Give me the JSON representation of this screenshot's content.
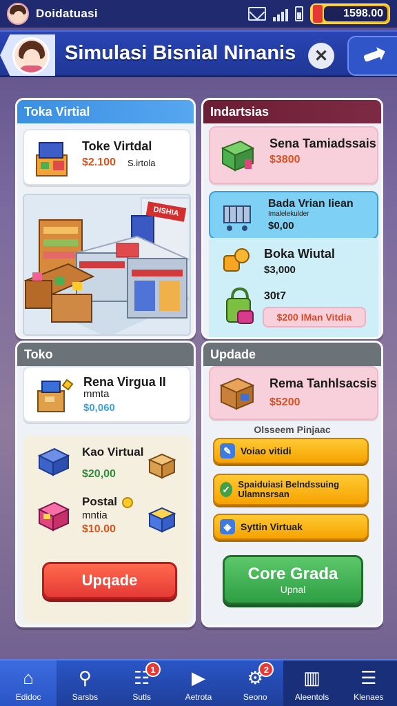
{
  "status_bar": {
    "title": "Doidatuasi",
    "coins": "1598.00"
  },
  "header": {
    "title": "Simulasi Bisnial Ninanis",
    "close_label": "✕"
  },
  "panel_toko_virtual": {
    "title": "Toka Virtial",
    "card": {
      "title": "Toke Virtdal",
      "price": "$2.100",
      "sub": "S.irtola"
    },
    "scene_sign": "DISHIA"
  },
  "panel_indartsias": {
    "title": "Indartsias",
    "items": [
      {
        "title": "Sena Tamiadssais",
        "price": "$3800"
      },
      {
        "title": "Bada Vrian Iiean",
        "subtitle": "Imalelekulder",
        "price": "$0,00"
      },
      {
        "title": "Boka Wiutal",
        "price": "$3,000"
      },
      {
        "title": "30t7",
        "button": "$200 IMan Vitdia"
      }
    ]
  },
  "panel_toko": {
    "title": "Toko",
    "card": {
      "title": "Rena Virgua II",
      "sub": "mmta",
      "price": "$0,060"
    },
    "items": [
      {
        "title": "Kao Virtual",
        "price": "$20,00"
      },
      {
        "title": "Postal",
        "sub": "mntia",
        "price": "$10.00"
      }
    ],
    "button": "Upqade"
  },
  "panel_update": {
    "title": "Updade",
    "card": {
      "title": "Rema Tanhlsacsis",
      "price": "$5200"
    },
    "section_label": "Olsseem Pinjaac",
    "buttons": [
      {
        "label": "Voiao vitidi",
        "icon_color": "#3d7be0"
      },
      {
        "label": "Spaiduiasi Belndssuing Ulamnsrsan",
        "icon_color": "#43a047"
      },
      {
        "label": "Syttin Virtuak",
        "icon_color": "#3d7be0"
      }
    ],
    "primary_button": {
      "label": "Core Grada",
      "sub": "Upnal"
    }
  },
  "bottom_nav": {
    "items": [
      {
        "label": "Edidoc",
        "icon": "home-icon"
      },
      {
        "label": "Sarsbs",
        "icon": "search-icon"
      },
      {
        "label": "Sutls",
        "icon": "list-icon",
        "badge": "1"
      },
      {
        "label": "Aetrota",
        "icon": "play-icon"
      },
      {
        "label": "Seono",
        "icon": "gear-icon",
        "badge": "2"
      },
      {
        "label": "Aleentols",
        "icon": "book-icon"
      },
      {
        "label": "Klenaes",
        "icon": "menu-icon"
      }
    ]
  },
  "colors": {
    "accent_blue": "#1f3796",
    "indartsias_head": "#6b1e35",
    "orange_button": "#f6a300",
    "red_button": "#e53935",
    "green_button": "#2e9e44"
  }
}
